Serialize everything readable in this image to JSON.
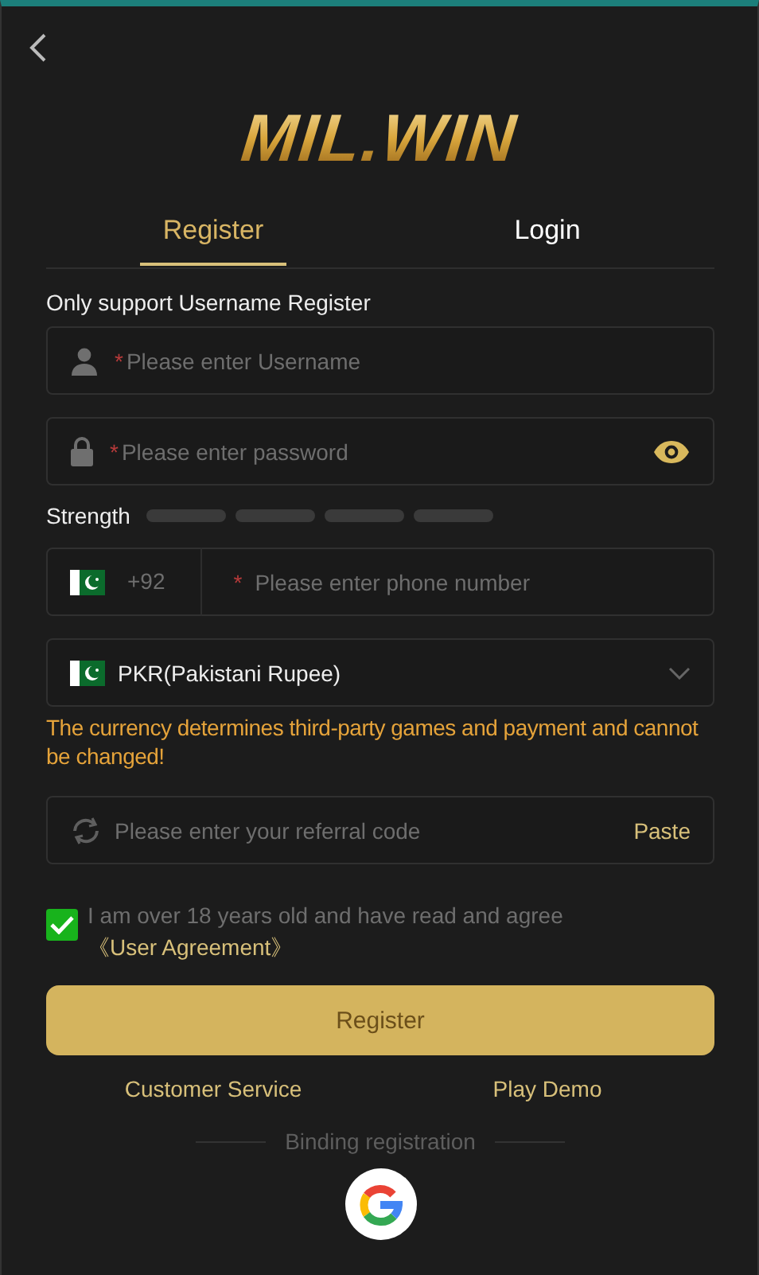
{
  "logo": "MIL.WIN",
  "tabs": [
    {
      "label": "Register",
      "selected": true
    },
    {
      "label": "Login",
      "selected": false
    }
  ],
  "notice": "Only support Username Register",
  "fields": [
    {
      "kind": "username",
      "mark": "*",
      "placeholder": "Please enter Username"
    },
    {
      "kind": "password",
      "mark": "*",
      "placeholder": "Please enter password"
    }
  ],
  "strength": {
    "label": "Strength"
  },
  "phone": {
    "country_code": "+92",
    "mark": "*",
    "placeholder": "Please enter phone number"
  },
  "currency": {
    "value": "PKR(Pakistani Rupee)"
  },
  "currency_warning": "The currency determines third-party games and payment and cannot be changed!",
  "referral": {
    "placeholder": "Please enter your referral code",
    "action": "Paste"
  },
  "agreement": {
    "checked": true,
    "text": "I am over 18 years old and have read and agree",
    "link": "《User Agreement》"
  },
  "submit": "Register",
  "links": [
    "Customer Service",
    "Play Demo"
  ],
  "binding": {
    "label": "Binding registration"
  }
}
